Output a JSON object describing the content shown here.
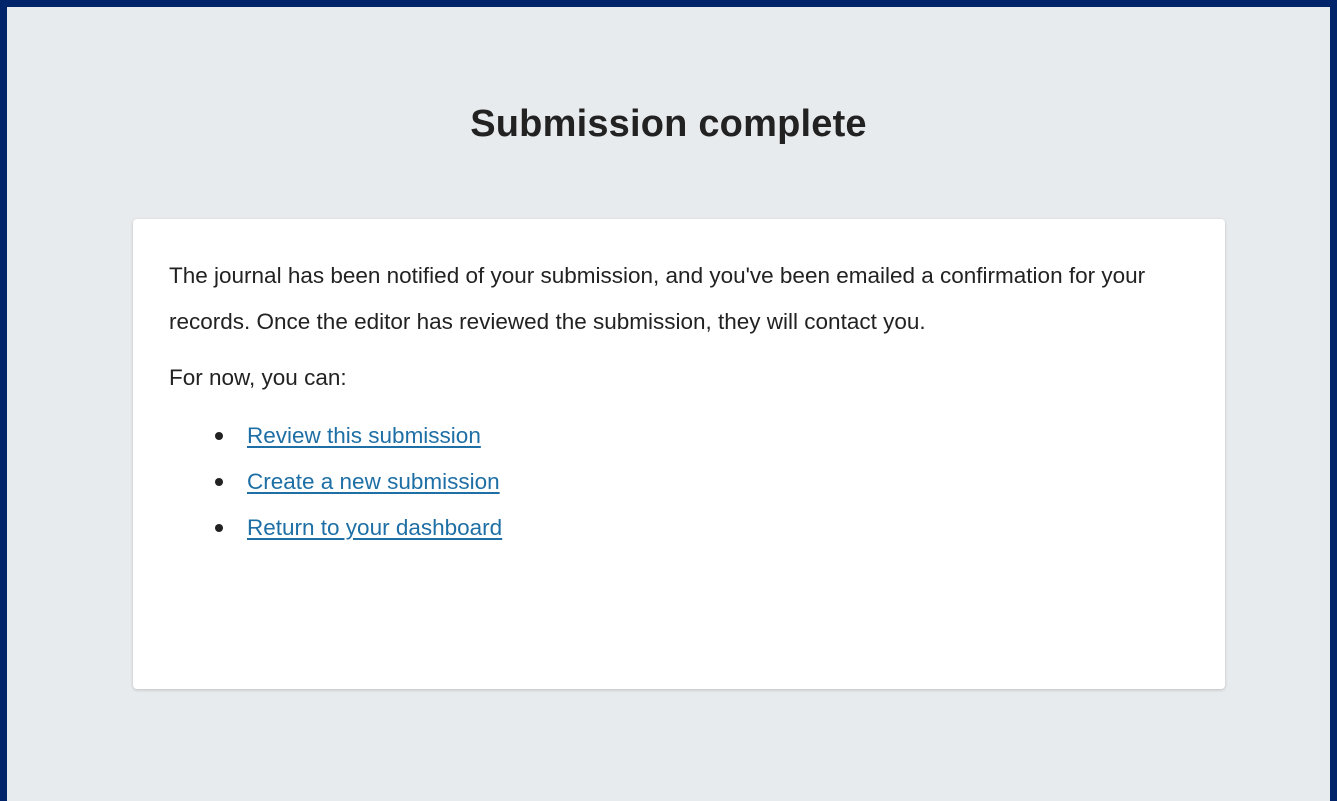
{
  "page": {
    "title": "Submission complete"
  },
  "card": {
    "message": "The journal has been notified of your submission, and you've been emailed a confirmation for your records. Once the editor has reviewed the submission, they will contact you.",
    "prompt": "For now, you can:",
    "actions": [
      {
        "label": "Review this submission"
      },
      {
        "label": "Create a new submission"
      },
      {
        "label": "Return to your dashboard"
      }
    ]
  },
  "colors": {
    "frame_border": "#002469",
    "page_background": "#e8ebed",
    "card_background": "#ffffff",
    "link": "#1e6fa5",
    "text": "#222222"
  }
}
